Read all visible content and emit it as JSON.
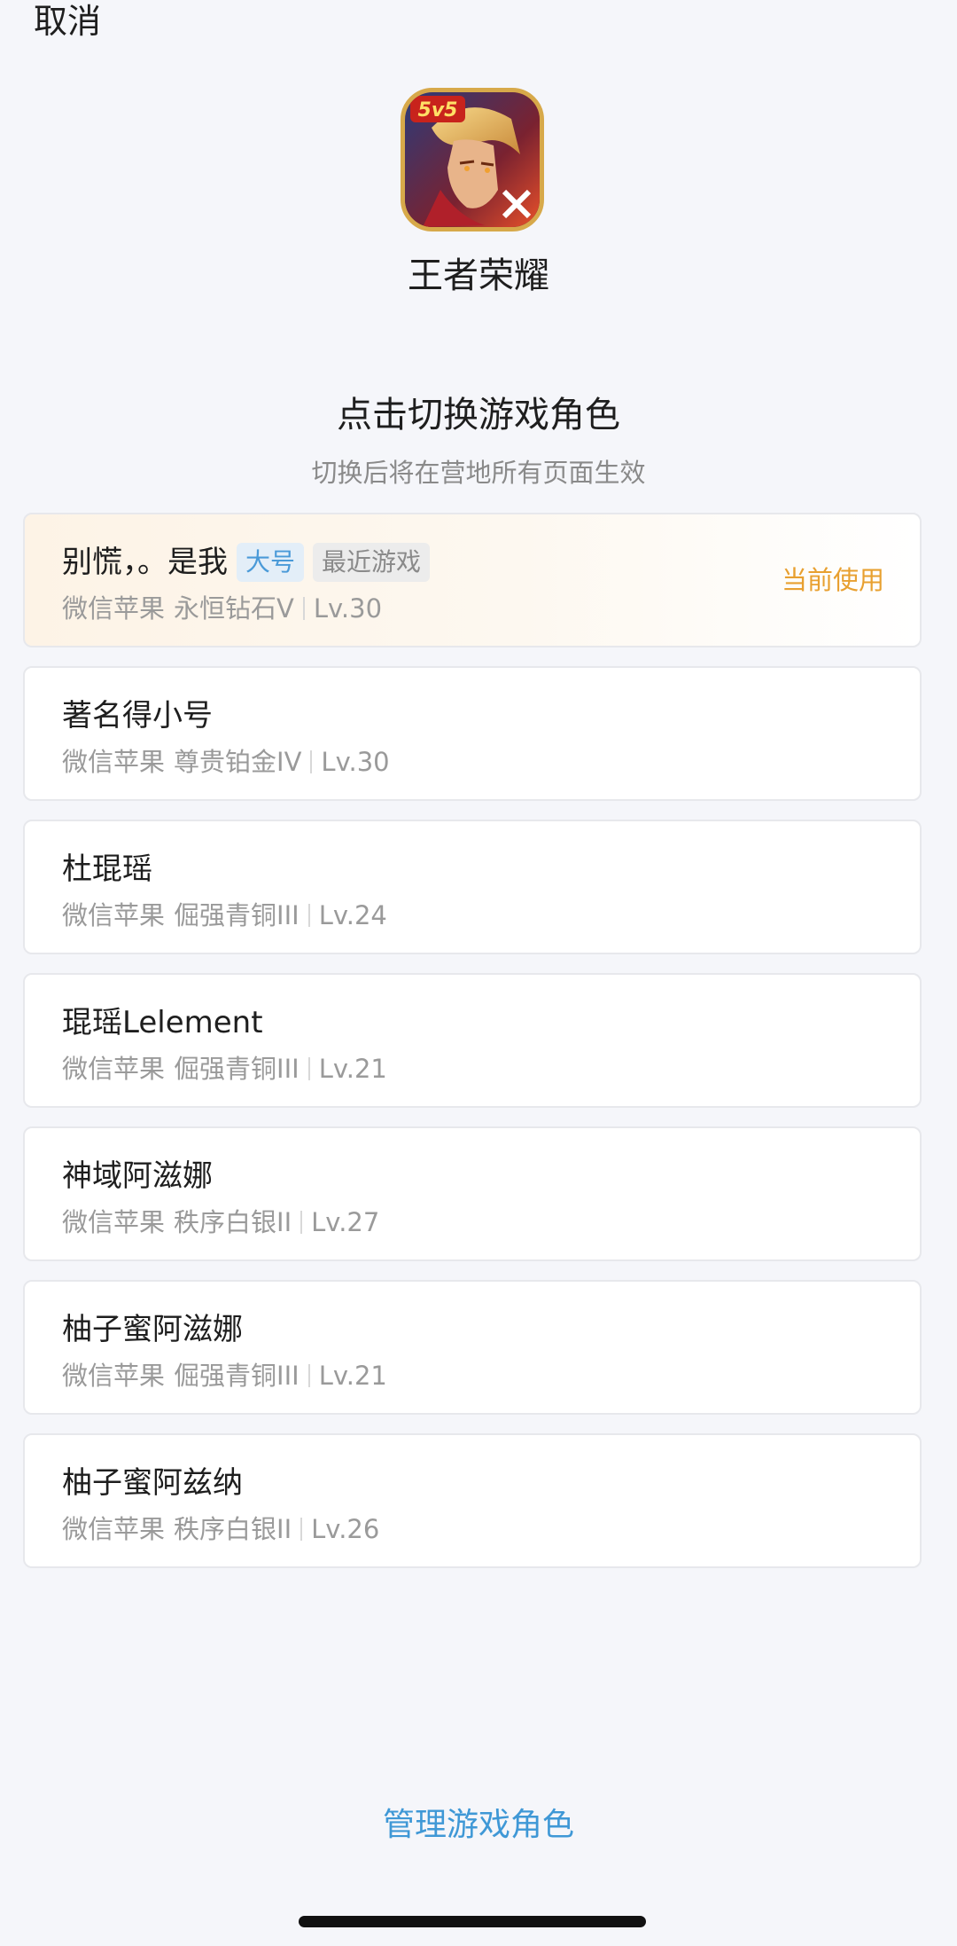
{
  "header": {
    "cancel_label": "取消"
  },
  "app": {
    "name": "王者荣耀",
    "icon": "game-app-icon",
    "icon_badge": "5v5"
  },
  "section": {
    "title": "点击切换游戏角色",
    "subtitle": "切换后将在营地所有页面生效"
  },
  "roles": [
    {
      "name": "别慌，。是我",
      "tags": [
        "大号",
        "最近游戏"
      ],
      "platform": "微信苹果",
      "rank": "永恒钻石V",
      "level": "Lv.30",
      "status": "当前使用"
    },
    {
      "name": "著名得小号",
      "platform": "微信苹果",
      "rank": "尊贵铂金IV",
      "level": "Lv.30"
    },
    {
      "name": "杜琨瑶",
      "platform": "微信苹果",
      "rank": "倔强青铜III",
      "level": "Lv.24"
    },
    {
      "name": "琨瑶Lelement",
      "platform": "微信苹果",
      "rank": "倔强青铜III",
      "level": "Lv.21"
    },
    {
      "name": "神域阿滋娜",
      "platform": "微信苹果",
      "rank": "秩序白银II",
      "level": "Lv.27"
    },
    {
      "name": "柚子蜜阿滋娜",
      "platform": "微信苹果",
      "rank": "倔强青铜III",
      "level": "Lv.21"
    },
    {
      "name": "柚子蜜阿兹纳",
      "platform": "微信苹果",
      "rank": "秩序白银II",
      "level": "Lv.26"
    }
  ],
  "footer": {
    "manage_label": "管理游戏角色"
  },
  "colors": {
    "accent_blue": "#3f98d6",
    "current_orange": "#e8a030",
    "background": "#f5f6fa"
  }
}
